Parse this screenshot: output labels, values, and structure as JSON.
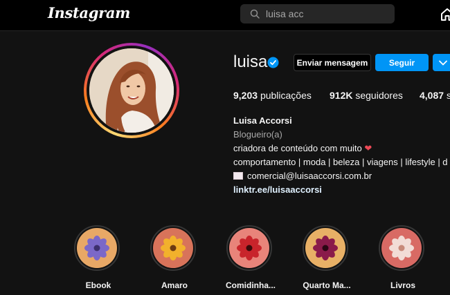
{
  "header": {
    "logo": "Instagram",
    "search_value": "luisa acc",
    "icons": [
      "search-icon",
      "home-icon"
    ]
  },
  "profile": {
    "username": "luisa",
    "verified": true,
    "message_button": "Enviar mensagem",
    "follow_button": "Seguir",
    "more_icon": "chevron-down-icon",
    "stats": {
      "posts_value": "9,203",
      "posts_label": "publicações",
      "followers_value": "912K",
      "followers_label": "seguidores",
      "following_value": "4,087",
      "following_label": "se"
    },
    "bio": {
      "name": "Luisa Accorsi",
      "category": "Blogueiro(a)",
      "line1": "criadora de conteúdo com muito",
      "line2": "comportamento | moda | beleza | viagens | lifestyle | d",
      "email": "comercial@luisaaccorsi.com.br",
      "link": "linktr.ee/luisaaccorsi"
    }
  },
  "highlights": [
    {
      "label": "Ebook",
      "bg": "#e8a866",
      "flower": "#7b68c8",
      "center": "#3d2f6e"
    },
    {
      "label": "Amaro",
      "bg": "#d8735a",
      "flower": "#f2b12c",
      "center": "#6b3a12"
    },
    {
      "label": "Comidinha...",
      "bg": "#e8847a",
      "flower": "#c8242b",
      "center": "#3a0a0a"
    },
    {
      "label": "Quarto Ma...",
      "bg": "#e8b066",
      "flower": "#8a1a4a",
      "center": "#2a0614"
    },
    {
      "label": "Livros",
      "bg": "#d86a64",
      "flower": "#f2dcd6",
      "center": "#c88a7a"
    }
  ],
  "colors": {
    "accent": "#0095f6",
    "background": "#121212",
    "heart": "#ed4956"
  }
}
